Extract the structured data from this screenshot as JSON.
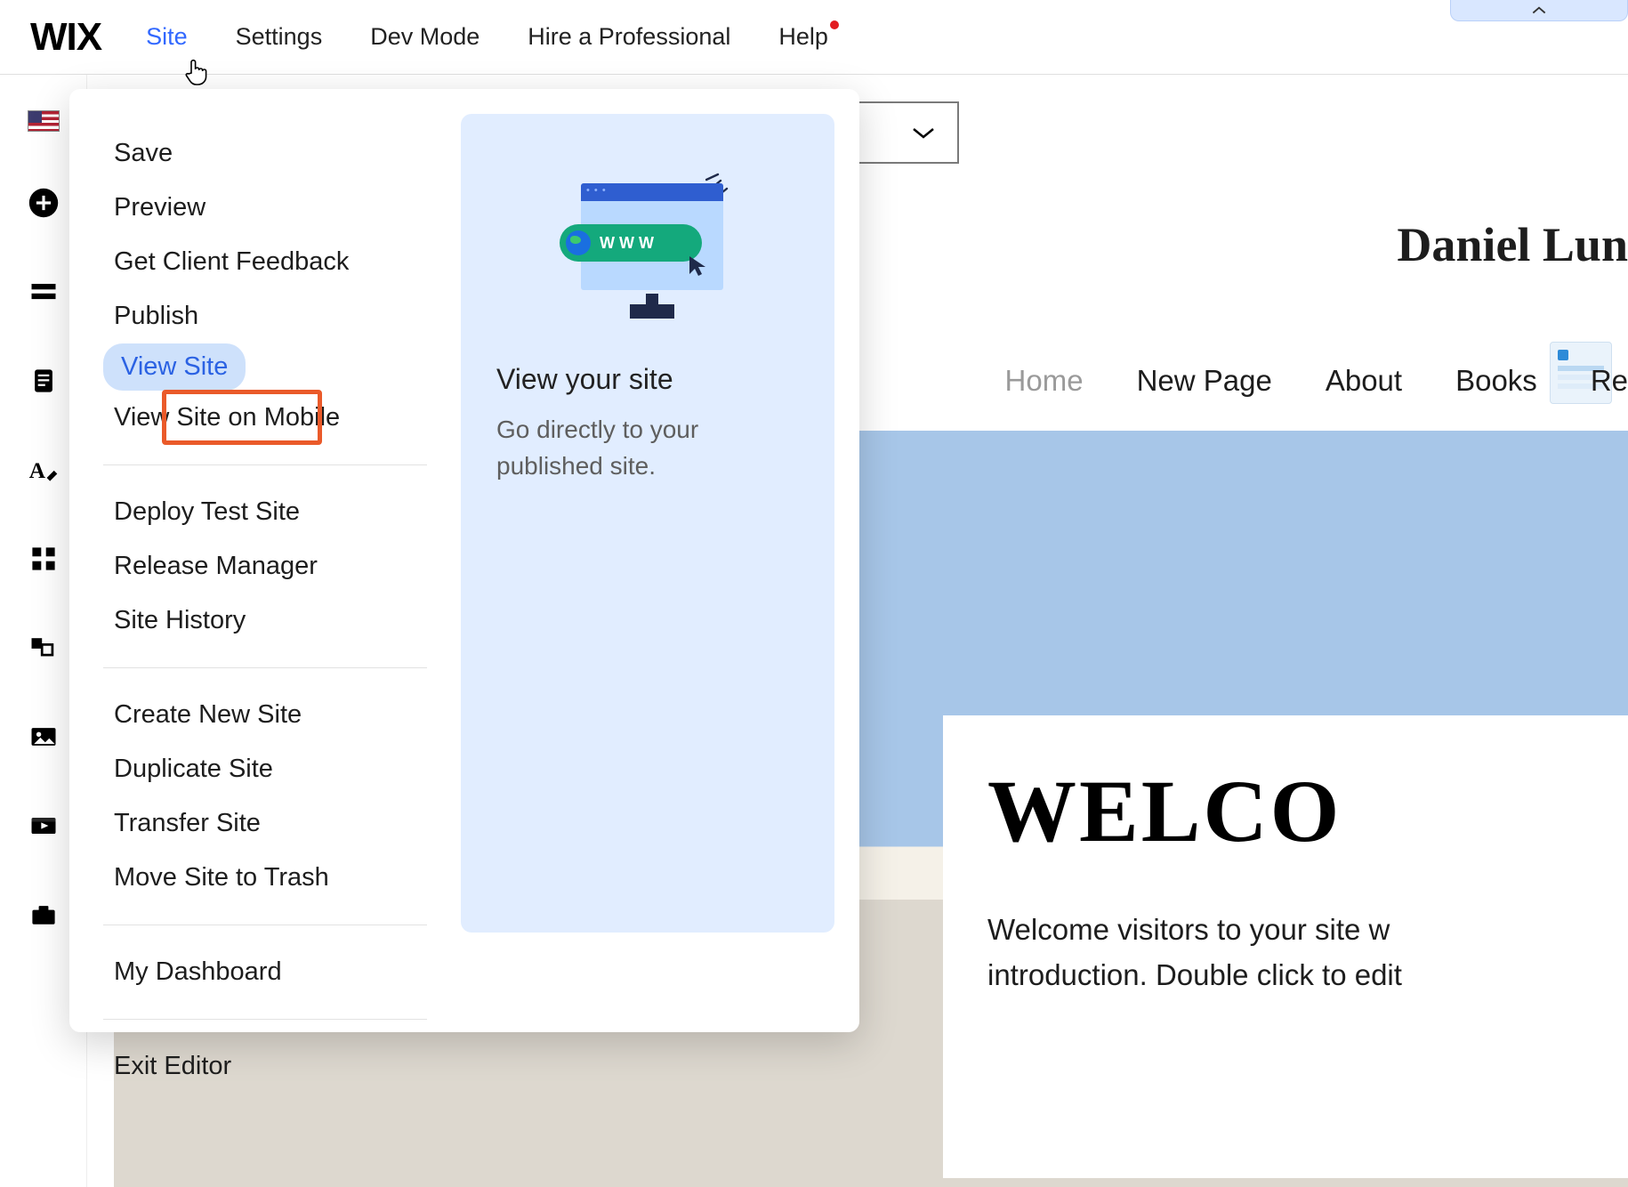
{
  "topbar": {
    "logo": "WIX",
    "menu": [
      "Site",
      "Settings",
      "Dev Mode",
      "Hire a Professional",
      "Help"
    ],
    "active_index": 0,
    "help_has_notification": true
  },
  "left_tools": [
    "flag-icon",
    "add-icon",
    "section-icon",
    "page-icon",
    "text-icon",
    "apps-icon",
    "layers-icon",
    "media-icon",
    "video-icon",
    "business-icon"
  ],
  "site_menu": {
    "groups": [
      [
        "Save",
        "Preview",
        "Get Client Feedback",
        "Publish",
        "View Site",
        "View Site on Mobile"
      ],
      [
        "Deploy Test Site",
        "Release Manager",
        "Site History"
      ],
      [
        "Create New Site",
        "Duplicate Site",
        "Transfer Site",
        "Move Site to Trash"
      ],
      [
        "My Dashboard"
      ],
      [
        "Exit Editor"
      ]
    ],
    "selected_label": "View Site",
    "preview": {
      "pill_text": "WWW",
      "title": "View your site",
      "description": "Go directly to your published site."
    }
  },
  "page": {
    "site_title": "Daniel Lun",
    "nav": [
      "Home",
      "New Page",
      "About",
      "Books",
      "Re"
    ],
    "current_nav_index": 0,
    "hero_heading": "WELCO",
    "hero_text_line1": "Welcome visitors to your site w",
    "hero_text_line2": "introduction. Double click to edit "
  }
}
